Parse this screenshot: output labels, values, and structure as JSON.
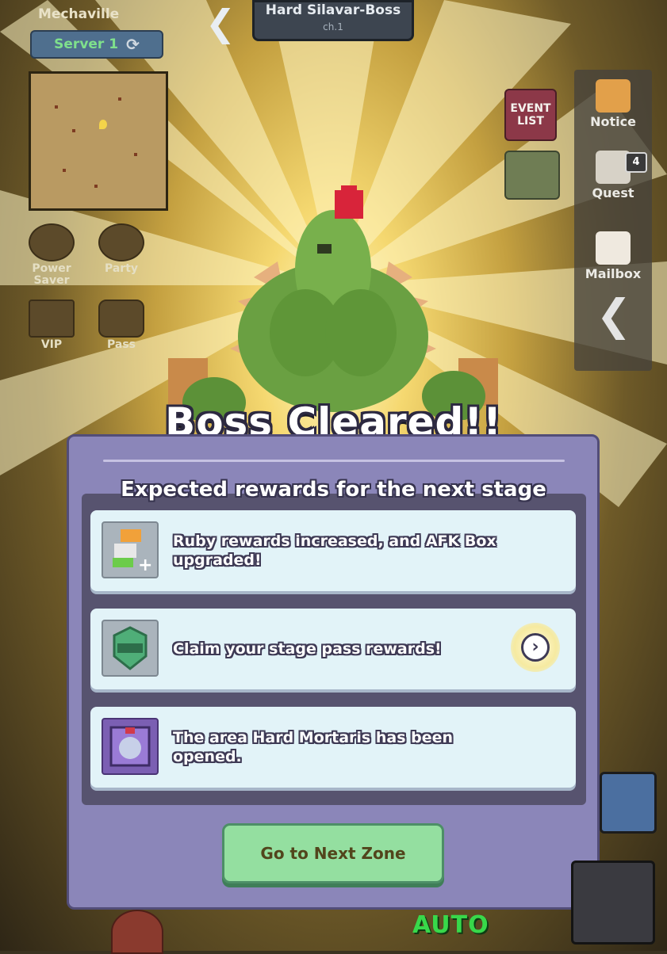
{
  "header": {
    "town": "Mechaville",
    "server": "Server 1",
    "stage_title": "Hard Silavar-Boss",
    "stage_chapter": "ch.1"
  },
  "left_menu": {
    "power_saver": "Power\nSaver",
    "party": "Party",
    "vip": "VIP",
    "pass": "Pass"
  },
  "right_menu": {
    "event_list": "EVENT\nLIST",
    "notice": "Notice",
    "quest": "Quest",
    "quest_badge": "4",
    "mailbox": "Mailbox"
  },
  "result": {
    "title": "Boss Cleared!!",
    "subtitle": "Expected rewards for the next stage",
    "rewards": [
      {
        "text": "Ruby rewards increased, and AFK Box upgraded!",
        "icon": "ruby-afk-box-icon",
        "has_go": false
      },
      {
        "text": "Claim your stage pass rewards!",
        "icon": "stage-pass-icon",
        "has_go": true
      },
      {
        "text": "The area Hard Mortaris has been opened.",
        "icon": "area-portal-icon",
        "has_go": false
      }
    ],
    "next_button": "Go to Next Zone"
  },
  "hud": {
    "auto": "AUTO"
  },
  "colors": {
    "panel": "#8b86b9",
    "card": "#e2f3f8",
    "next_button": "#94dfa0",
    "server_text": "#7fe08c"
  }
}
